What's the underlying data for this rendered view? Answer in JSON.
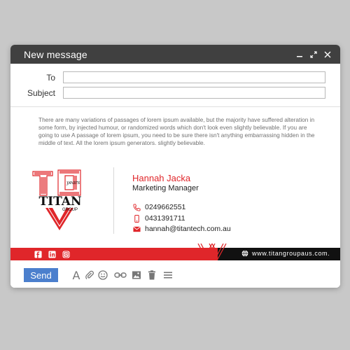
{
  "window": {
    "title": "New message",
    "controls": [
      "minimize-icon",
      "expand-icon",
      "close-icon"
    ]
  },
  "fields": {
    "to_label": "To",
    "to_value": "",
    "subject_label": "Subject",
    "subject_value": ""
  },
  "body_text": "There are many variations of passages of lorem ipsum available, but the majority have suffered alteration in some form, by injected humour, or randomized words which don't look even slightly believable. If you are going to use A passage of lorem ipsum, you need to be sure there isn't anything embarrassing hidden in the middle of text. All the lorem ipsum generators. slightly believable.",
  "signature": {
    "logo": {
      "number": "10",
      "years": "years",
      "brand": "TITAN",
      "sub": "GROUP"
    },
    "name": "Hannah Jacka",
    "role": "Marketing Manager",
    "phone": "0249662551",
    "mobile": "0431391711",
    "email": "hannah@titantech.com.au",
    "website": "www.titangroupaus.com.",
    "social": [
      "facebook-icon",
      "linkedin-icon",
      "instagram-icon"
    ]
  },
  "toolbar": {
    "send_label": "Send",
    "tools": [
      "format-text-icon",
      "attach-icon",
      "emoji-icon",
      "link-icon",
      "image-icon",
      "delete-icon",
      "more-options-icon"
    ]
  },
  "colors": {
    "brand_red": "#e0262a",
    "titlebar": "#404040",
    "send_blue": "#4b7fcd",
    "banner_black": "#111111"
  }
}
